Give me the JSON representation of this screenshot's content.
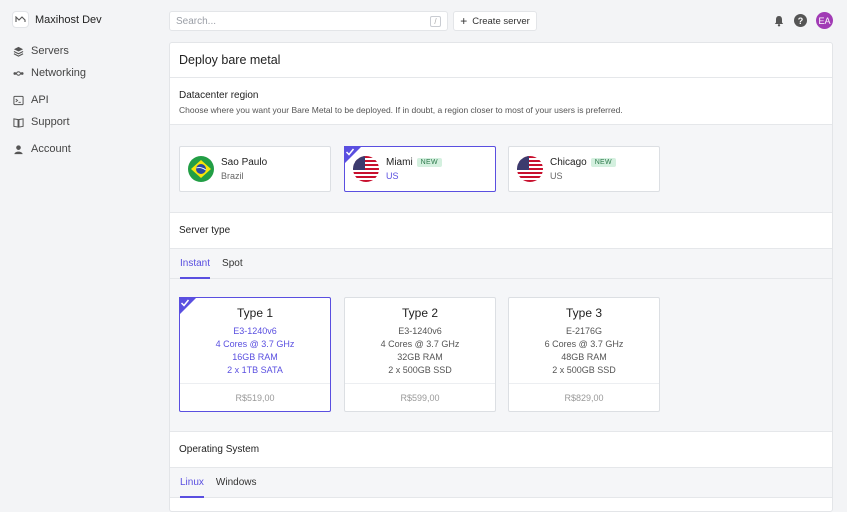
{
  "app": {
    "name": "Maxihost Dev"
  },
  "sidebar": {
    "items": [
      {
        "label": "Servers",
        "icon": "layers-icon"
      },
      {
        "label": "Networking",
        "icon": "network-icon"
      },
      {
        "label": "API",
        "icon": "terminal-icon"
      },
      {
        "label": "Support",
        "icon": "book-icon"
      },
      {
        "label": "Account",
        "icon": "user-icon"
      }
    ]
  },
  "topbar": {
    "search_placeholder": "Search...",
    "search_shortcut": "/",
    "create_label": "Create server",
    "create_icon": "+",
    "avatar_initials": "EA",
    "help_glyph": "?"
  },
  "page": {
    "title": "Deploy bare metal",
    "datacenter": {
      "title": "Datacenter region",
      "description": "Choose where you want your Bare Metal to be deployed. If in doubt, a region closer to most of your users is preferred.",
      "regions": [
        {
          "name": "Sao Paulo",
          "country": "Brazil",
          "badge": "",
          "flag": "brazil-flag",
          "selected": false
        },
        {
          "name": "Miami",
          "country": "US",
          "badge": "NEW",
          "flag": "us-flag",
          "selected": true
        },
        {
          "name": "Chicago",
          "country": "US",
          "badge": "NEW",
          "flag": "us-flag",
          "selected": false
        }
      ]
    },
    "server_type": {
      "title": "Server type",
      "tabs": [
        {
          "label": "Instant",
          "active": true
        },
        {
          "label": "Spot",
          "active": false
        }
      ],
      "servers": [
        {
          "name": "Type 1",
          "cpu": "E3-1240v6",
          "cores": "4 Cores @ 3.7 GHz",
          "ram": "16GB RAM",
          "storage": "2 x 1TB SATA",
          "price": "R$519,00",
          "selected": true
        },
        {
          "name": "Type 2",
          "cpu": "E3-1240v6",
          "cores": "4 Cores @ 3.7 GHz",
          "ram": "32GB RAM",
          "storage": "2 x 500GB SSD",
          "price": "R$599,00",
          "selected": false
        },
        {
          "name": "Type 3",
          "cpu": "E-2176G",
          "cores": "6 Cores @ 3.7 GHz",
          "ram": "48GB RAM",
          "storage": "2 x 500GB SSD",
          "price": "R$829,00",
          "selected": false
        }
      ]
    },
    "os": {
      "title": "Operating System",
      "tabs": [
        {
          "label": "Linux",
          "active": true
        },
        {
          "label": "Windows",
          "active": false
        }
      ]
    }
  },
  "colors": {
    "accent": "#5a4fe0",
    "avatar": "#a13bb5",
    "badge_bg": "#d4f0df",
    "badge_text": "#2c7a4b"
  }
}
